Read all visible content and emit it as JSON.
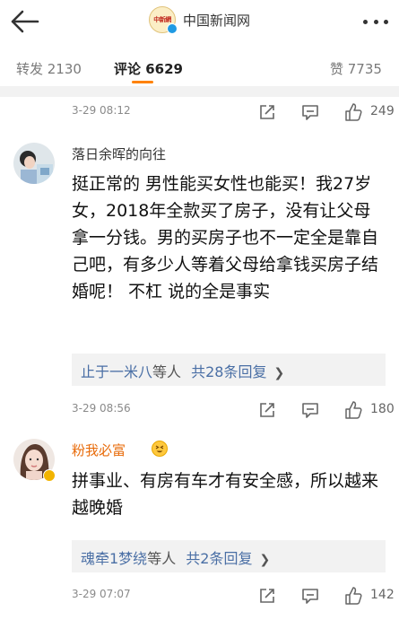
{
  "header": {
    "account_name": "中国新闻网",
    "logo_text": "中新網"
  },
  "tabs": [
    {
      "label": "转发 2130"
    },
    {
      "label": "评论 6629"
    },
    {
      "label": "赞 7735"
    }
  ],
  "rows": [
    {
      "time": "3-29 08:12",
      "likes": "249"
    },
    {
      "time": "3-29 08:56",
      "likes": "180"
    },
    {
      "time": "3-29 07:07",
      "likes": "142"
    }
  ],
  "comments": [
    {
      "username": "落日余晖的向往",
      "text": "挺正常的 男性能买女性也能买！我27岁 女，2018年全款买了房子，没有让父母拿一分钱。男的买房子也不一定全是靠自己吧，有多少人等着父母给拿钱买房子结婚呢！ 不杠 说的全是事实",
      "reply_names": "止于一米八",
      "reply_mid": "等人",
      "reply_count": "共28条回复"
    },
    {
      "username": "粉我必富",
      "text": "拼事业、有房有车才有安全感，所以越来越晚婚",
      "reply_names": "魂牵1梦绕",
      "reply_mid": "等人",
      "reply_count": "共2条回复"
    }
  ],
  "colors": {
    "accent": "#ff8200",
    "link": "#4a6fa5",
    "badge": "#1f9ae3"
  }
}
